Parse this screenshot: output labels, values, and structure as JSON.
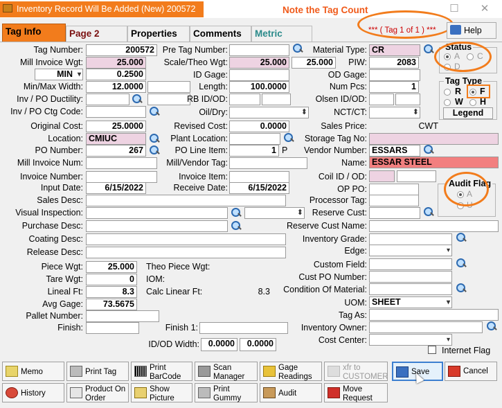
{
  "window": {
    "title": "Inventory Record Will Be Added  (New) 200572",
    "note": "Note the Tag Count"
  },
  "tabs": [
    {
      "label": "Tag Info"
    },
    {
      "label": "Page 2"
    },
    {
      "label": "Properties"
    },
    {
      "label": "Comments"
    },
    {
      "label": "Metric"
    }
  ],
  "tag_count": "***     ( Tag 1 of 1 )     ***",
  "help_label": "Help",
  "left": {
    "tag_number": {
      "label": "Tag Number:",
      "value": "200572"
    },
    "mill_invoice_wgt": {
      "label": "Mill Invoice Wgt:",
      "value": "25.000"
    },
    "min_max": {
      "select": "MIN",
      "value": "0.2500"
    },
    "min_max_width": {
      "label": "Min/Max Width:",
      "value": "12.0000"
    },
    "inv_po_ductility": {
      "label": "Inv / PO Ductility:"
    },
    "inv_po_ctg_code": {
      "label": "Inv / PO Ctg Code:"
    },
    "original_cost": {
      "label": "Original Cost:",
      "value": "25.0000"
    },
    "location": {
      "label": "Location:",
      "value": "CMIUC"
    },
    "po_number": {
      "label": "PO Number:",
      "value": "267"
    },
    "mill_invoice_num": {
      "label": "Mill Invoice Num:"
    },
    "invoice_number": {
      "label": "Invoice Number:"
    },
    "input_date": {
      "label": "Input Date:",
      "value": "6/15/2022"
    },
    "sales_desc": {
      "label": "Sales Desc:"
    },
    "visual_inspection": {
      "label": "Visual Inspection:"
    },
    "purchase_desc": {
      "label": "Purchase Desc:"
    },
    "coating_desc": {
      "label": "Coating Desc:"
    },
    "release_desc": {
      "label": "Release Desc:"
    },
    "piece_wgt": {
      "label": "Piece Wgt:",
      "value": "25.000"
    },
    "tare_wgt": {
      "label": "Tare Wgt:",
      "value": "0"
    },
    "lineal_ft": {
      "label": "Lineal Ft:",
      "value": "8.3"
    },
    "avg_gage": {
      "label": "Avg Gage:",
      "value": "73.5675"
    },
    "pallet_number": {
      "label": "Pallet Number:"
    },
    "finish": {
      "label": "Finish:"
    }
  },
  "middle": {
    "pre_tag_number": {
      "label": "Pre Tag Number:"
    },
    "scale_theo_wgt": {
      "label": "Scale/Theo Wgt:",
      "value1": "25.000",
      "value2": "25.000"
    },
    "id_gage": {
      "label": "ID Gage:"
    },
    "length": {
      "label": "Length:",
      "value": "100.0000"
    },
    "rb_id_od": {
      "label": "RB ID/OD:"
    },
    "oil_dry": {
      "label": "Oil/Dry:"
    },
    "revised_cost": {
      "label": "Revised Cost:",
      "value": "0.0000"
    },
    "plant_location": {
      "label": "Plant Location:"
    },
    "po_line_item": {
      "label": "PO Line Item:",
      "value": "1",
      "suffix": "P"
    },
    "mill_vendor_tag": {
      "label": "Mill/Vendor Tag:"
    },
    "invoice_item": {
      "label": "Invoice Item:"
    },
    "receive_date": {
      "label": "Receive Date:",
      "value": "6/15/2022"
    },
    "theo_piece_wgt": {
      "label": "Theo Piece Wgt:"
    },
    "iom": {
      "label": "IOM:"
    },
    "calc_linear_ft": {
      "label": "Calc Linear Ft:",
      "value": "8.3"
    },
    "finish1": {
      "label": "Finish 1:"
    },
    "id_od_width": {
      "label": "ID/OD Width:",
      "value1": "0.0000",
      "value2": "0.0000"
    }
  },
  "right": {
    "material_type": {
      "label": "Material Type:",
      "value": "CR"
    },
    "piw": {
      "label": "PIW:",
      "value": "2083"
    },
    "od_gage": {
      "label": "OD Gage:"
    },
    "num_pcs": {
      "label": "Num Pcs:",
      "value": "1"
    },
    "olsen_id_od": {
      "label": "Olsen ID/OD:"
    },
    "nct_ct": {
      "label": "NCT/CT:"
    },
    "sales_price": {
      "label": "Sales Price:",
      "unit": "CWT"
    },
    "storage_tag_no": {
      "label": "Storage Tag No:"
    },
    "vendor_number": {
      "label": "Vendor Number:",
      "value": "ESSARS"
    },
    "name": {
      "label": "Name:",
      "value": "ESSAR STEEL"
    },
    "coil_id_od": {
      "label": "Coil ID / OD:"
    },
    "op_po": {
      "label": "OP PO:"
    },
    "processor_tag": {
      "label": "Processor Tag:"
    },
    "reserve_cust": {
      "label": "Reserve Cust:"
    },
    "reserve_cust_name": {
      "label": "Reserve Cust Name:"
    },
    "inventory_grade": {
      "label": "Inventory Grade:"
    },
    "edge": {
      "label": "Edge:"
    },
    "custom_field": {
      "label": "Custom Field:"
    },
    "cust_po_number": {
      "label": "Cust PO Number:"
    },
    "condition_of_material": {
      "label": "Condition Of Material:"
    },
    "uom": {
      "label": "UOM:",
      "value": "SHEET"
    },
    "tag_as": {
      "label": "Tag As:"
    },
    "inventory_owner": {
      "label": "Inventory Owner:"
    },
    "cost_center": {
      "label": "Cost Center:"
    },
    "internet_flag": {
      "label": "Internet Flag"
    }
  },
  "status_group": {
    "title": "Status",
    "options": [
      "A",
      "C",
      "D"
    ],
    "selected": "A"
  },
  "tag_type_group": {
    "title": "Tag Type",
    "options": [
      "R",
      "F",
      "W",
      "H"
    ],
    "selected": "F",
    "legend": "Legend"
  },
  "audit_flag_group": {
    "title": "Audit Flag",
    "options": [
      "A",
      "U"
    ],
    "selected": "A"
  },
  "buttons": {
    "memo": "Memo",
    "print_tag": "Print Tag",
    "print_barcode_1": "Print",
    "print_barcode_2": "BarCode",
    "scan_1": "Scan",
    "scan_2": "Manager",
    "gage_1": "Gage",
    "gage_2": "Readings",
    "xfr_1": "xfr to",
    "xfr_2": "CUSTOMER",
    "save": "Save",
    "cancel": "Cancel",
    "history": "History",
    "product_1": "Product On",
    "product_2": "Order",
    "show_1": "Show",
    "show_2": "Picture",
    "gummy_1": "Print",
    "gummy_2": "Gummy",
    "audit": "Audit",
    "move_1": "Move",
    "move_2": "Request"
  }
}
